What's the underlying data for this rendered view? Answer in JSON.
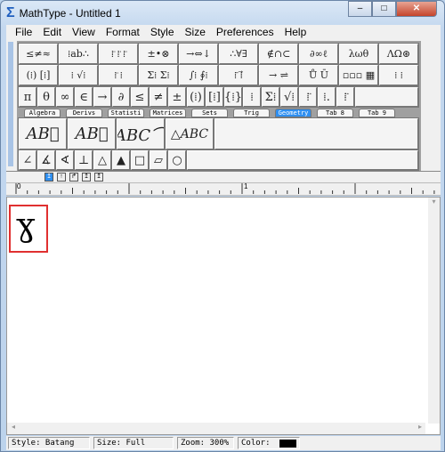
{
  "window": {
    "title": "MathType - Untitled 1",
    "logo": "Σ",
    "minimize": "–",
    "maximize": "□",
    "close": "✕"
  },
  "menu": [
    "File",
    "Edit",
    "View",
    "Format",
    "Style",
    "Size",
    "Preferences",
    "Help"
  ],
  "palette_row1": [
    "≤≠≈",
    "⁞ab∴",
    "⁞̈ ⁞̈ ⁞̈",
    "±•⊗",
    "→⇔↓",
    "∴∀∃",
    "∉∩⊂",
    "∂∞ℓ",
    "λωθ",
    "ΛΩ⊛"
  ],
  "palette_row2": [
    "(⁞) [⁞]",
    "⁞ √⁞",
    "⁞̈ ⁞",
    "Σ⁞ Σ⁞",
    "∫⁞ ∮⁞",
    "⁞̄ ⁞⃗",
    "→ ⇌",
    "Ů Ū",
    "▫▫▫ ▦",
    "⁞ ⁞"
  ],
  "palette_row3": [
    "π",
    "θ",
    "∞",
    "∈",
    "→",
    "∂",
    "≤",
    "≠",
    "±",
    "(⁞)",
    "[⁞]",
    "{⁞}",
    "⁞",
    "Σ⁞",
    "√⁞",
    "⁞̈",
    "⁞.",
    "⁞̈"
  ],
  "tabs": [
    {
      "label": "Algebra"
    },
    {
      "label": "Derivs"
    },
    {
      "label": "Statisti"
    },
    {
      "label": "Matrices"
    },
    {
      "label": "Sets"
    },
    {
      "label": "Trig"
    },
    {
      "label": "Geometry",
      "active": true
    },
    {
      "label": "Tab 8"
    },
    {
      "label": "Tab 9"
    }
  ],
  "templates": [
    "AB⃗",
    "AB⃡",
    "ABC⌒",
    "△ABC"
  ],
  "geometry_symbols": [
    "∠",
    "∡",
    "∢",
    "⊥",
    "△",
    "▲",
    "□",
    "▱",
    "○"
  ],
  "nudge_buttons": [
    "↥",
    "↑",
    "↱",
    "↥",
    "↥"
  ],
  "ruler": {
    "mark0": "0",
    "mark1": "1"
  },
  "editor": {
    "content": "ɣ"
  },
  "status": {
    "style": "Style: Batang",
    "size": "Size: Full",
    "zoom": "Zoom: 300%",
    "color_label": "Color:",
    "color": "#000000"
  },
  "scroll": {
    "left": "◂",
    "right": "▸",
    "down": "▾"
  }
}
